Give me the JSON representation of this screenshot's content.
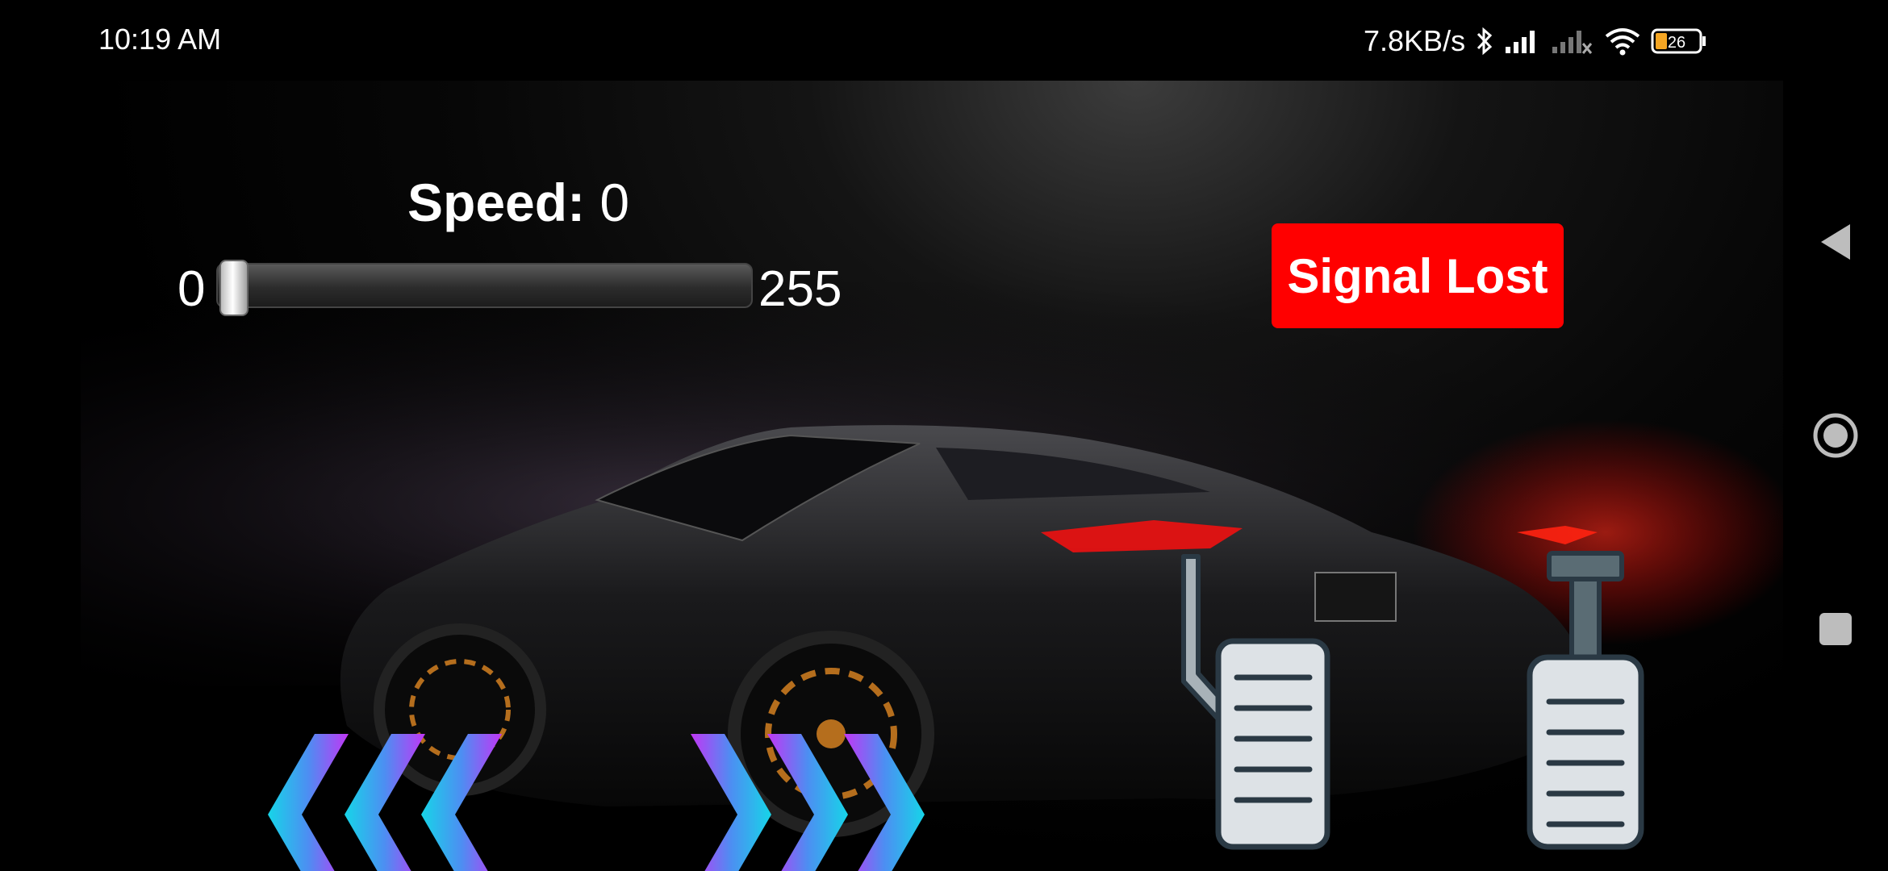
{
  "status_bar": {
    "time": "10:19 AM",
    "net_speed": "7.8KB/s",
    "battery": "26",
    "icons": [
      "bluetooth-icon",
      "signal-icon",
      "signal-disabled-icon",
      "wifi-icon",
      "battery-icon"
    ]
  },
  "speed": {
    "label": "Speed:",
    "value": "0",
    "slider_min": "0",
    "slider_max": "255",
    "slider_fraction": 0
  },
  "signal": {
    "status": "Signal Lost",
    "color": "#ff0000"
  },
  "controls": {
    "left_icon": "chevron-left-triple-icon",
    "right_icon": "chevron-right-triple-icon",
    "brake_icon": "brake-pedal-icon",
    "gas_icon": "gas-pedal-icon",
    "arrow_colors": [
      "#16d5e8",
      "#4d8ef2",
      "#c236f5"
    ]
  },
  "nav_bar": {
    "icons": [
      "back-icon",
      "home-icon",
      "recents-icon"
    ]
  }
}
